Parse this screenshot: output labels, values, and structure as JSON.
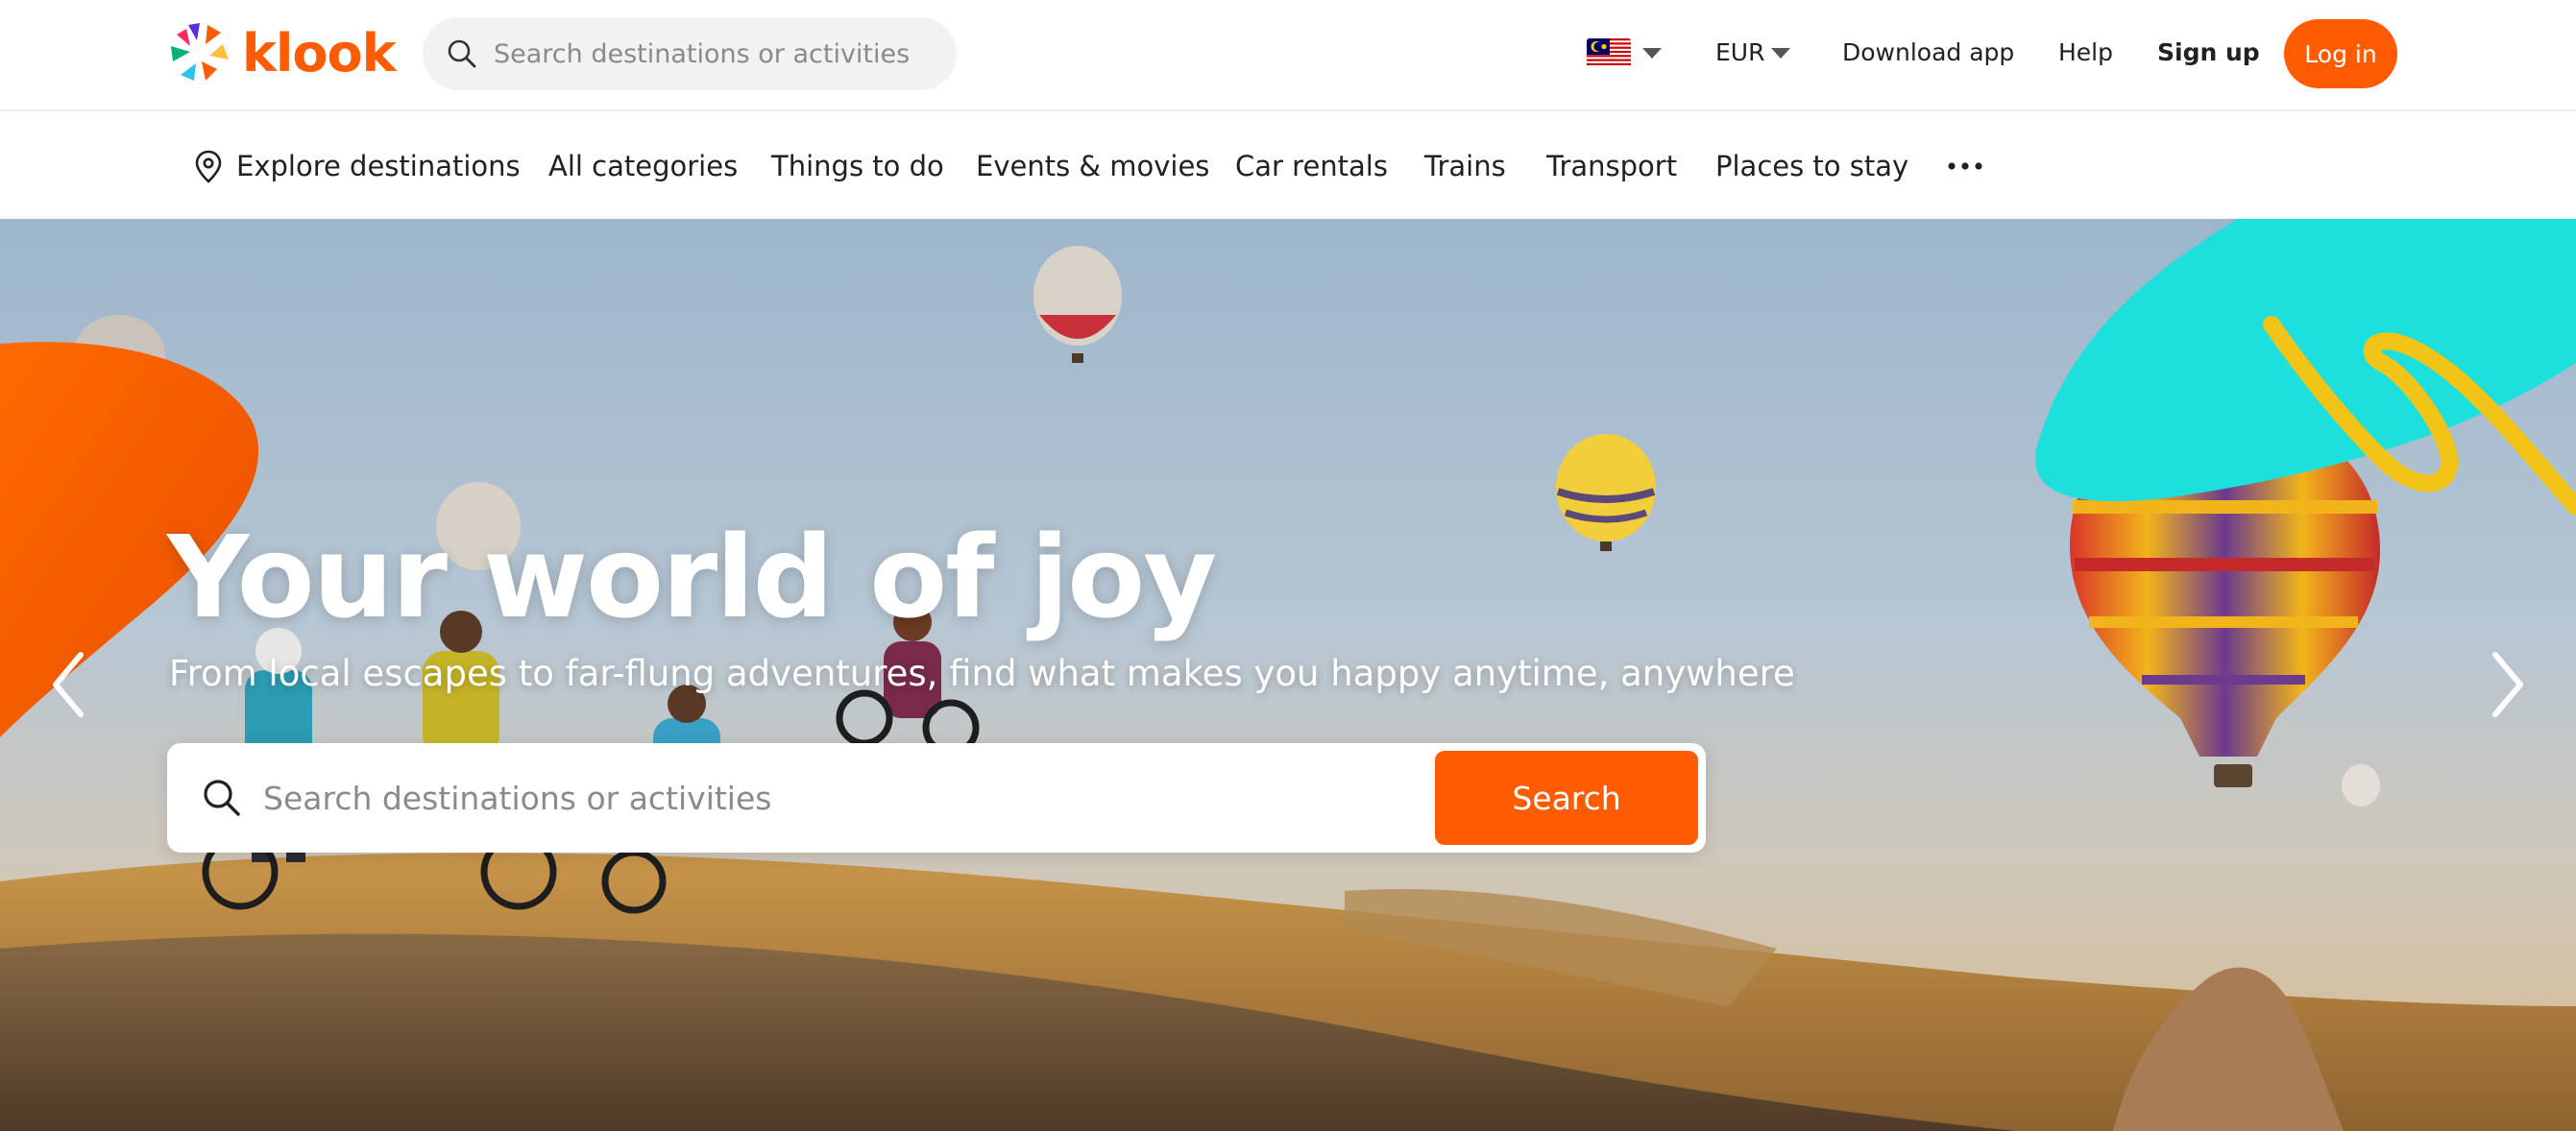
{
  "brand": {
    "name": "klook",
    "accent": "#ff5b00"
  },
  "header": {
    "search_placeholder": "Search destinations or activities",
    "currency": "EUR",
    "links": {
      "download_app": "Download app",
      "help": "Help",
      "sign_up": "Sign up",
      "log_in": "Log in"
    }
  },
  "categories": [
    {
      "label": "Explore destinations",
      "icon": "location-pin-icon"
    },
    {
      "label": "All categories"
    },
    {
      "label": "Things to do"
    },
    {
      "label": "Events & movies"
    },
    {
      "label": "Car rentals"
    },
    {
      "label": "Trains"
    },
    {
      "label": "Transport"
    },
    {
      "label": "Places to stay"
    }
  ],
  "hero": {
    "title": "Your world of joy",
    "subtitle": "From local escapes to far-flung adventures, find what makes you happy anytime, anywhere",
    "search_placeholder": "Search destinations or activities",
    "search_button": "Search"
  }
}
